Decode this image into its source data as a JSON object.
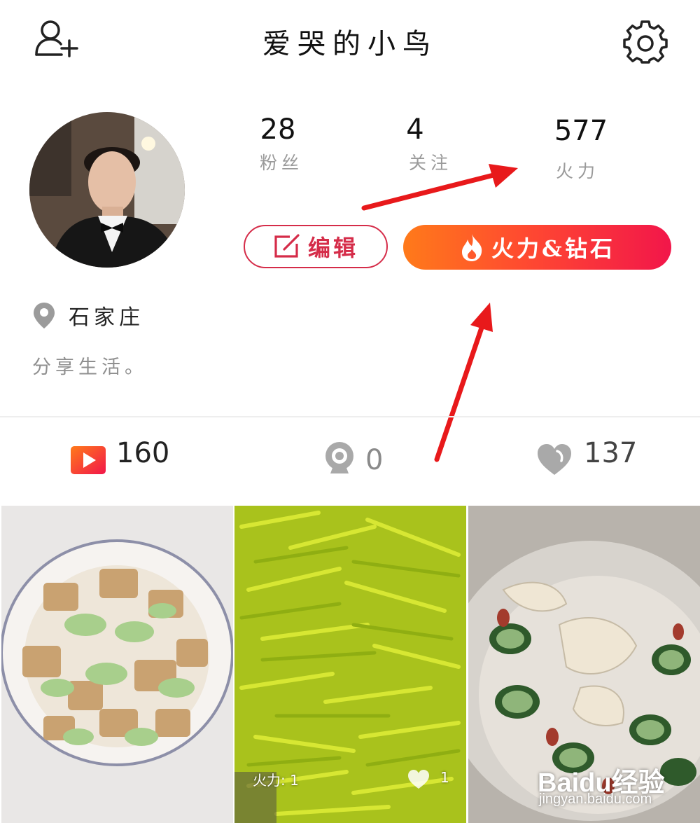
{
  "header": {
    "title": "爱哭的小鸟"
  },
  "icons": {
    "add_user": "add-user-icon",
    "settings": "gear-icon",
    "edit": "edit-icon",
    "fire": "fire-icon",
    "location": "location-pin-icon",
    "video": "video-icon",
    "webcam": "webcam-icon",
    "heart": "heart-icon"
  },
  "stats": [
    {
      "value": "28",
      "label": "粉丝"
    },
    {
      "value": "4",
      "label": "关注"
    },
    {
      "value": "577",
      "label": "火力"
    }
  ],
  "buttons": {
    "edit": "编辑",
    "fire": "火力&钻石"
  },
  "profile": {
    "location": "石家庄",
    "bio": "分享生活。"
  },
  "counts": {
    "videos": "160",
    "live": "0",
    "likes": "137"
  },
  "thumbnails": [
    {
      "name": "tofu-celery-dish"
    },
    {
      "name": "daylily-pile",
      "fire_label": "火力: 1",
      "likes": "1"
    },
    {
      "name": "cucumber-salad"
    }
  ],
  "watermark": {
    "logo": "Baidu经验",
    "url": "jingyan.baidu.com"
  },
  "colors": {
    "accent_red": "#d52c49",
    "gradient_start": "#ff7a1a",
    "gradient_end": "#f2164a",
    "arrow": "#e8191b"
  }
}
